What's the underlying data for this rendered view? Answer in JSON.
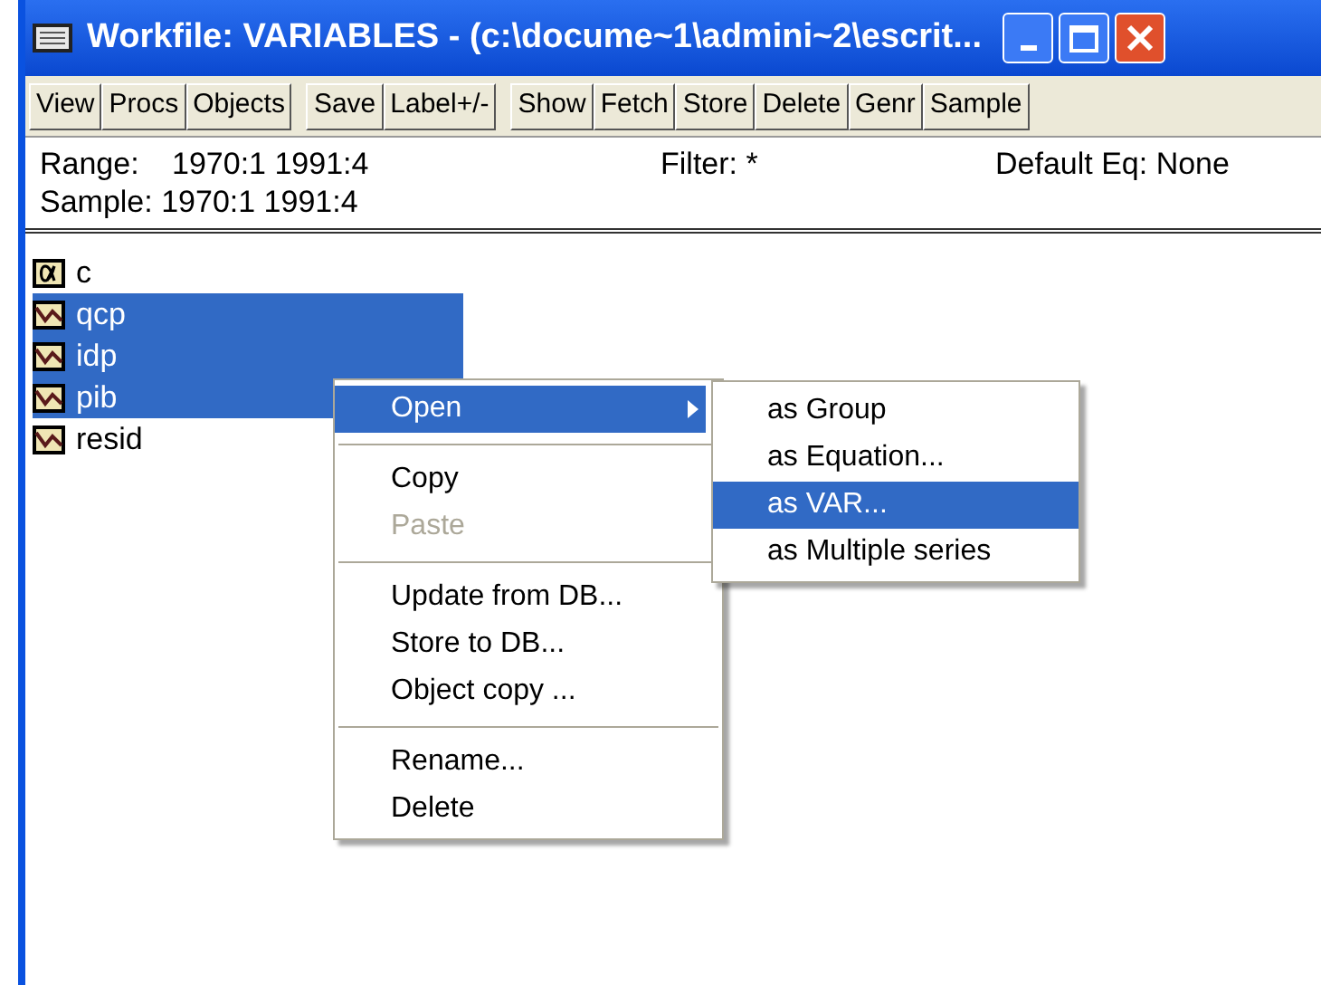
{
  "window": {
    "title": "Workfile: VARIABLES - (c:\\docume~1\\admini~2\\escrit..."
  },
  "toolbar_groups": [
    [
      "View",
      "Procs",
      "Objects"
    ],
    [
      "Save",
      "Label+/-"
    ],
    [
      "Show",
      "Fetch",
      "Store",
      "Delete",
      "Genr",
      "Sample"
    ]
  ],
  "info": {
    "range_label": "Range:",
    "range": "1970:1 1991:4",
    "filter": "Filter: *",
    "default_eq": "Default Eq: None",
    "sample": "Sample: 1970:1 1991:4"
  },
  "objects": [
    {
      "name": "c",
      "kind": "scalar",
      "selected": false
    },
    {
      "name": "qcp",
      "kind": "series",
      "selected": true
    },
    {
      "name": "idp",
      "kind": "series",
      "selected": true
    },
    {
      "name": "pib",
      "kind": "series",
      "selected": true
    },
    {
      "name": "resid",
      "kind": "series",
      "selected": false
    }
  ],
  "context_menu": [
    {
      "kind": "item",
      "label": "Open",
      "selected": true,
      "disabled": false,
      "submenu": true
    },
    {
      "kind": "separator"
    },
    {
      "kind": "item",
      "label": "Copy",
      "selected": false,
      "disabled": false,
      "submenu": false
    },
    {
      "kind": "item",
      "label": "Paste",
      "selected": false,
      "disabled": true,
      "submenu": false
    },
    {
      "kind": "separator"
    },
    {
      "kind": "item",
      "label": "Update from DB...",
      "selected": false,
      "disabled": false,
      "submenu": false
    },
    {
      "kind": "item",
      "label": "Store to DB...",
      "selected": false,
      "disabled": false,
      "submenu": false
    },
    {
      "kind": "item",
      "label": "Object copy ...",
      "selected": false,
      "disabled": false,
      "submenu": false
    },
    {
      "kind": "separator"
    },
    {
      "kind": "item",
      "label": "Rename...",
      "selected": false,
      "disabled": false,
      "submenu": false
    },
    {
      "kind": "item",
      "label": "Delete",
      "selected": false,
      "disabled": false,
      "submenu": false
    }
  ],
  "submenu": [
    {
      "label": "as Group",
      "selected": false
    },
    {
      "label": "as Equation...",
      "selected": false
    },
    {
      "label": "as VAR...",
      "selected": true
    },
    {
      "label": "as Multiple series",
      "selected": false
    }
  ]
}
